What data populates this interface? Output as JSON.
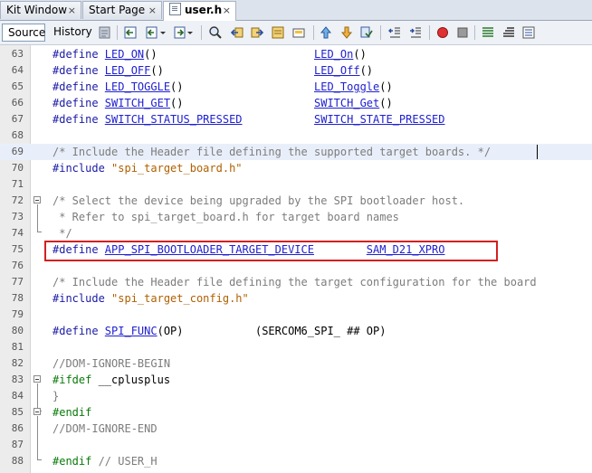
{
  "tabs": [
    {
      "label": "Kit Window",
      "close": "×"
    },
    {
      "label": "Start Page",
      "close": "×"
    },
    {
      "label": "user.h",
      "close": "×"
    }
  ],
  "toolbar": {
    "source_label": "Source",
    "history_label": "History"
  },
  "lines": [
    {
      "num": "63",
      "tokens": [
        [
          "pp",
          "#define "
        ],
        [
          "macro-u",
          "LED_ON"
        ],
        [
          "txt",
          "()"
        ],
        [
          "sp",
          "                        "
        ],
        [
          "macro-u",
          "LED_On"
        ],
        [
          "txt",
          "()"
        ]
      ]
    },
    {
      "num": "64",
      "tokens": [
        [
          "pp",
          "#define "
        ],
        [
          "macro-u",
          "LED_OFF"
        ],
        [
          "txt",
          "()"
        ],
        [
          "sp",
          "                       "
        ],
        [
          "macro-u",
          "LED_Off"
        ],
        [
          "txt",
          "()"
        ]
      ]
    },
    {
      "num": "65",
      "tokens": [
        [
          "pp",
          "#define "
        ],
        [
          "macro-u",
          "LED_TOGGLE"
        ],
        [
          "txt",
          "()"
        ],
        [
          "sp",
          "                    "
        ],
        [
          "macro-u",
          "LED_Toggle"
        ],
        [
          "txt",
          "()"
        ]
      ]
    },
    {
      "num": "66",
      "tokens": [
        [
          "pp",
          "#define "
        ],
        [
          "macro-u",
          "SWITCH_GET"
        ],
        [
          "txt",
          "()"
        ],
        [
          "sp",
          "                    "
        ],
        [
          "macro-u",
          "SWITCH_Get"
        ],
        [
          "txt",
          "()"
        ]
      ]
    },
    {
      "num": "67",
      "tokens": [
        [
          "pp",
          "#define "
        ],
        [
          "macro-u",
          "SWITCH_STATUS_PRESSED"
        ],
        [
          "sp",
          "           "
        ],
        [
          "macro-u",
          "SWITCH_STATE_PRESSED"
        ]
      ]
    },
    {
      "num": "68",
      "tokens": []
    },
    {
      "num": "69",
      "tokens": [
        [
          "cm",
          "/* Include the Header file defining the supported target boards. */"
        ]
      ]
    },
    {
      "num": "70",
      "tokens": [
        [
          "pp",
          "#include "
        ],
        [
          "str",
          "\"spi_target_board.h\""
        ]
      ]
    },
    {
      "num": "71",
      "tokens": []
    },
    {
      "num": "72",
      "tokens": [
        [
          "cm",
          "/* Select the device being upgraded by the SPI bootloader host."
        ]
      ]
    },
    {
      "num": "73",
      "tokens": [
        [
          "cm",
          " * Refer to spi_target_board.h for target board names"
        ]
      ]
    },
    {
      "num": "74",
      "tokens": [
        [
          "cm",
          " */"
        ]
      ]
    },
    {
      "num": "75",
      "tokens": [
        [
          "pp",
          "#define "
        ],
        [
          "macro-u",
          "APP_SPI_BOOTLOADER_TARGET_DEVICE"
        ],
        [
          "sp",
          "        "
        ],
        [
          "macro-u",
          "SAM_D21_XPRO"
        ]
      ]
    },
    {
      "num": "76",
      "tokens": []
    },
    {
      "num": "77",
      "tokens": [
        [
          "cm",
          "/* Include the Header file defining the target configuration for the board"
        ]
      ]
    },
    {
      "num": "78",
      "tokens": [
        [
          "pp",
          "#include "
        ],
        [
          "str",
          "\"spi_target_config.h\""
        ]
      ]
    },
    {
      "num": "79",
      "tokens": []
    },
    {
      "num": "80",
      "tokens": [
        [
          "pp",
          "#define "
        ],
        [
          "macro-u",
          "SPI_FUNC"
        ],
        [
          "txt",
          "(OP)"
        ],
        [
          "sp",
          "           "
        ],
        [
          "txt",
          "(SERCOM6_SPI_ ## OP)"
        ]
      ]
    },
    {
      "num": "81",
      "tokens": []
    },
    {
      "num": "82",
      "tokens": [
        [
          "cm",
          "//DOM-IGNORE-BEGIN"
        ]
      ]
    },
    {
      "num": "83",
      "tokens": [
        [
          "kw",
          "#ifdef "
        ],
        [
          "txt",
          "__cplusplus"
        ]
      ]
    },
    {
      "num": "84",
      "tokens": [
        [
          "cm",
          "}"
        ]
      ]
    },
    {
      "num": "85",
      "tokens": [
        [
          "kw",
          "#endif"
        ]
      ]
    },
    {
      "num": "86",
      "tokens": [
        [
          "cm",
          "//DOM-IGNORE-END"
        ]
      ]
    },
    {
      "num": "87",
      "tokens": []
    },
    {
      "num": "88",
      "tokens": [
        [
          "kw",
          "#endif "
        ],
        [
          "cm",
          "// USER_H"
        ]
      ]
    }
  ]
}
